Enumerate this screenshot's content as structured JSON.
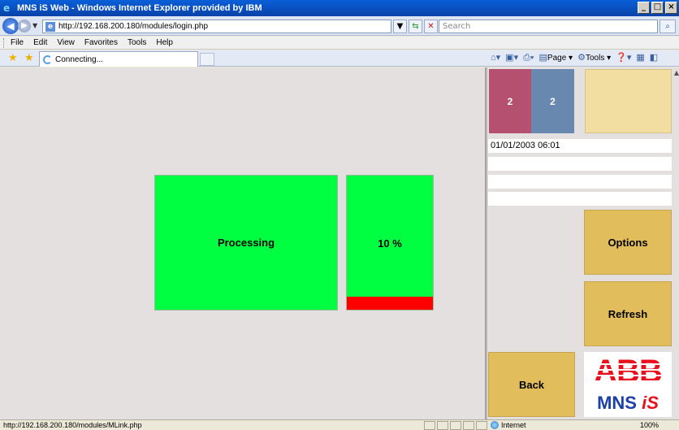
{
  "window": {
    "title": "MNS iS Web - Windows Internet Explorer provided by IBM",
    "minimize": "_",
    "maximize": "□",
    "close": "×"
  },
  "address": {
    "url": "http://192.168.200.180/modules/login.php",
    "search_placeholder": "Search"
  },
  "menu": {
    "items": [
      "File",
      "Edit",
      "View",
      "Favorites",
      "Tools",
      "Help"
    ]
  },
  "tab": {
    "label": "Connecting..."
  },
  "commandbar": {
    "page": "Page",
    "tools": "Tools"
  },
  "main": {
    "processing_label": "Processing",
    "progress": 10,
    "progress_label": "10 %"
  },
  "side": {
    "counter_a": "2",
    "counter_b": "2",
    "datetime": "01/01/2003 06:01",
    "info2": "",
    "info3": "",
    "info4": "",
    "options_label": "Options",
    "refresh_label": "Refresh",
    "back_label": "Back",
    "logo_abb": "ABB",
    "logo_mns": "MNS",
    "logo_is": "iS",
    "colors": {
      "counter_a": "#b55070",
      "counter_b": "#6888b0",
      "status_green": "#00ff41",
      "progress_red": "#ff0000",
      "button_gold": "#e2bd5c"
    }
  },
  "status": {
    "text": "http://192.168.200.180/modules/MLink.php",
    "zone": "Internet",
    "zoom": "100%"
  }
}
